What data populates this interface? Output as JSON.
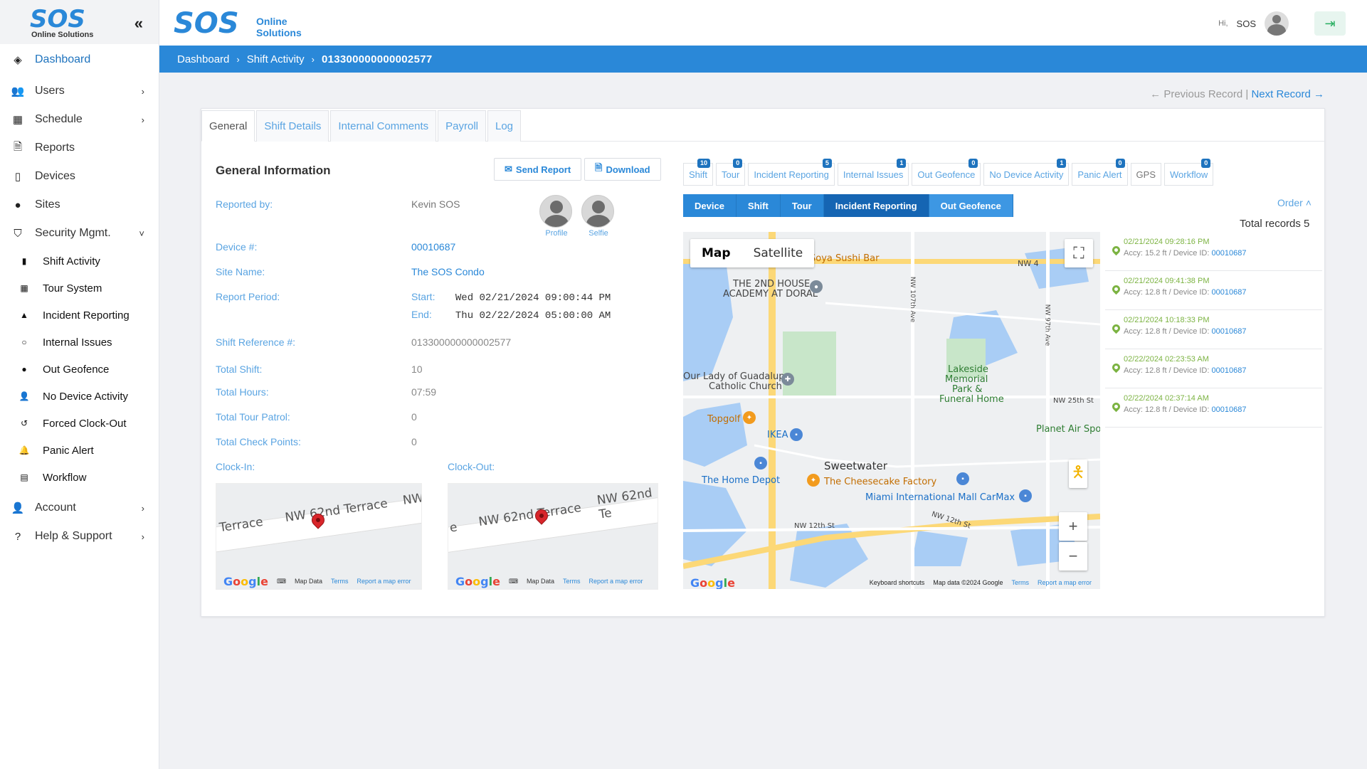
{
  "brand": {
    "logo_text": "SOS",
    "logo_sub": "Online Solutions",
    "header_line1": "Online",
    "header_line2": "Solutions"
  },
  "header": {
    "greeting": "Hi,",
    "username": "SOS"
  },
  "sidebar": {
    "items": [
      {
        "label": "Dashboard",
        "icon": "layers-icon",
        "active": true
      },
      {
        "label": "Users",
        "icon": "users-icon",
        "chevron": true
      },
      {
        "label": "Schedule",
        "icon": "calendar-icon",
        "chevron": true
      },
      {
        "label": "Reports",
        "icon": "report-icon"
      },
      {
        "label": "Devices",
        "icon": "mobile-icon"
      },
      {
        "label": "Sites",
        "icon": "location-icon"
      },
      {
        "label": "Security Mgmt.",
        "icon": "shield-icon",
        "chevron_down": true
      }
    ],
    "sub_items": [
      {
        "label": "Shift Activity",
        "icon": "file-icon"
      },
      {
        "label": "Tour System",
        "icon": "grid-icon"
      },
      {
        "label": "Incident Reporting",
        "icon": "warning-icon"
      },
      {
        "label": "Internal Issues",
        "icon": "comment-icon"
      },
      {
        "label": "Out Geofence",
        "icon": "pin-icon"
      },
      {
        "label": "No Device Activity",
        "icon": "user-slash-icon"
      },
      {
        "label": "Forced Clock-Out",
        "icon": "history-icon"
      },
      {
        "label": "Panic Alert",
        "icon": "bell-icon"
      },
      {
        "label": "Workflow",
        "icon": "clipboard-icon"
      }
    ],
    "bottom_items": [
      {
        "label": "Account",
        "icon": "user-gear-icon"
      },
      {
        "label": "Help & Support",
        "icon": "question-icon"
      }
    ]
  },
  "breadcrumb": {
    "home": "Dashboard",
    "section": "Shift Activity",
    "current": "013300000000002577"
  },
  "record_nav": {
    "prev": "Previous Record",
    "sep": "|",
    "next": "Next Record"
  },
  "tabs": [
    {
      "label": "General",
      "active": true
    },
    {
      "label": "Shift Details"
    },
    {
      "label": "Internal Comments"
    },
    {
      "label": "Payroll"
    },
    {
      "label": "Log"
    }
  ],
  "general": {
    "title": "General Information",
    "send_report": "Send Report",
    "download": "Download",
    "reported_by_label": "Reported by:",
    "reported_by": "Kevin SOS",
    "profile_caption": "Profile",
    "selfie_caption": "Selfie",
    "device_label": "Device #:",
    "device": "00010687",
    "site_label": "Site Name:",
    "site": "The SOS Condo",
    "period_label": "Report Period:",
    "start_label": "Start:",
    "start": "Wed 02/21/2024 09:00:44 PM",
    "end_label": "End:",
    "end": "Thu 02/22/2024 05:00:00 AM",
    "shift_ref_label": "Shift Reference #:",
    "shift_ref": "013300000000002577",
    "total_shift_label": "Total Shift:",
    "total_shift": "10",
    "total_hours_label": "Total Hours:",
    "total_hours": "07:59",
    "total_tour_label": "Total Tour Patrol:",
    "total_tour": "0",
    "total_cp_label": "Total Check Points:",
    "total_cp": "0",
    "clock_in_label": "Clock-In:",
    "clock_out_label": "Clock-Out:"
  },
  "mini_map": {
    "in_labels": [
      "Terrace",
      "NW 62nd Terrace",
      "NW"
    ],
    "out_labels": [
      "e",
      "NW 62nd Terrace",
      "NW 62nd Te"
    ],
    "footer_data": "Map Data",
    "footer_terms": "Terms",
    "footer_report": "Report a map error"
  },
  "filters": [
    {
      "label": "Shift",
      "count": "10"
    },
    {
      "label": "Tour",
      "count": "0"
    },
    {
      "label": "Incident Reporting",
      "count": "5"
    },
    {
      "label": "Internal Issues",
      "count": "1"
    },
    {
      "label": "Out Geofence",
      "count": "0"
    },
    {
      "label": "No Device Activity",
      "count": "1"
    },
    {
      "label": "Panic Alert",
      "count": "0"
    },
    {
      "label": "GPS",
      "count": ""
    },
    {
      "label": "Workflow",
      "count": "0"
    }
  ],
  "segments": [
    {
      "label": "Device"
    },
    {
      "label": "Shift"
    },
    {
      "label": "Tour"
    },
    {
      "label": "Incident Reporting",
      "active": true
    },
    {
      "label": "Out Geofence"
    }
  ],
  "order_label": "Order",
  "total_records": "Total records 5",
  "big_map": {
    "map_btn": "Map",
    "sat_btn": "Satellite",
    "labels": {
      "soya": "Soya Sushi Bar",
      "nw4": "NW 4",
      "academy1": "THE 2ND HOUSE",
      "academy2": "ACADEMY AT DORAL",
      "lady1": "Our Lady of Guadalupe",
      "lady2": "Catholic Church",
      "lakeside1": "Lakeside",
      "lakeside2": "Memorial",
      "lakeside3": "Park &",
      "lakeside4": "Funeral Home",
      "nw25": "NW 25th St",
      "topgolf": "Topgolf",
      "ikea": "IKEA",
      "planet": "Planet Air Spo",
      "sweetwater": "Sweetwater",
      "homedepot": "The Home Depot",
      "cheesecake": "The Cheesecake Factory",
      "miamimall": "Miami International Mall CarMax",
      "nw12": "NW 12th St",
      "nw12b": "NW 12th St",
      "nw107": "NW 107th Ave",
      "nw97": "NW 97th Ave"
    },
    "footer_keys": "Keyboard shortcuts",
    "footer_data": "Map data ©2024 Google",
    "footer_terms": "Terms",
    "footer_report": "Report a map error"
  },
  "records": [
    {
      "date": "02/21/2024 09:28:16 PM",
      "accy": "Accy: 15.2 ft / Device ID:",
      "device": "00010687"
    },
    {
      "date": "02/21/2024 09:41:38 PM",
      "accy": "Accy: 12.8 ft / Device ID:",
      "device": "00010687"
    },
    {
      "date": "02/21/2024 10:18:33 PM",
      "accy": "Accy: 12.8 ft / Device ID:",
      "device": "00010687"
    },
    {
      "date": "02/22/2024 02:23:53 AM",
      "accy": "Accy: 12.8 ft / Device ID:",
      "device": "00010687"
    },
    {
      "date": "02/22/2024 02:37:14 AM",
      "accy": "Accy: 12.8 ft / Device ID:",
      "device": "00010687"
    }
  ],
  "colors": {
    "primary": "#2a88d8",
    "dark_primary": "#1565b3",
    "accent_green": "#7cb342"
  }
}
